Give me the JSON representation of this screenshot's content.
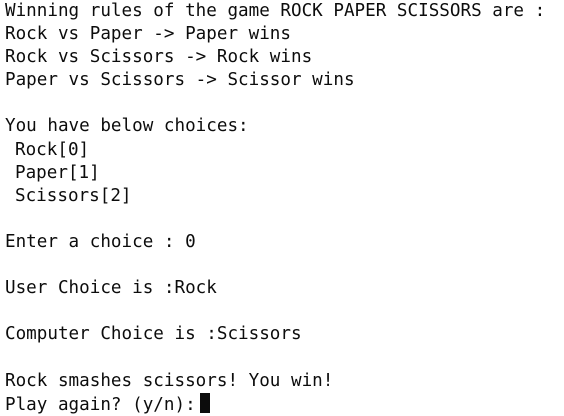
{
  "console": {
    "rules_header": "Winning rules of the game ROCK PAPER SCISSORS are :",
    "rule_1": "Rock vs Paper -> Paper wins",
    "rule_2": "Rock vs Scissors -> Rock wins",
    "rule_3": "Paper vs Scissors -> Scissor wins",
    "choices_header": "You have below choices:",
    "choice_0": "Rock[0]",
    "choice_1": "Paper[1]",
    "choice_2": "Scissors[2]",
    "enter_prompt": "Enter a choice : 0",
    "user_choice": "User Choice is :Rock",
    "computer_choice": "Computer Choice is :Scissors",
    "result": "Rock smashes scissors! You win!",
    "play_again_prompt": "Play again? (y/n):"
  },
  "icons": {
    "cursor": "block-cursor"
  },
  "colors": {
    "background": "#ffffff",
    "text": "#0c0c0c"
  }
}
